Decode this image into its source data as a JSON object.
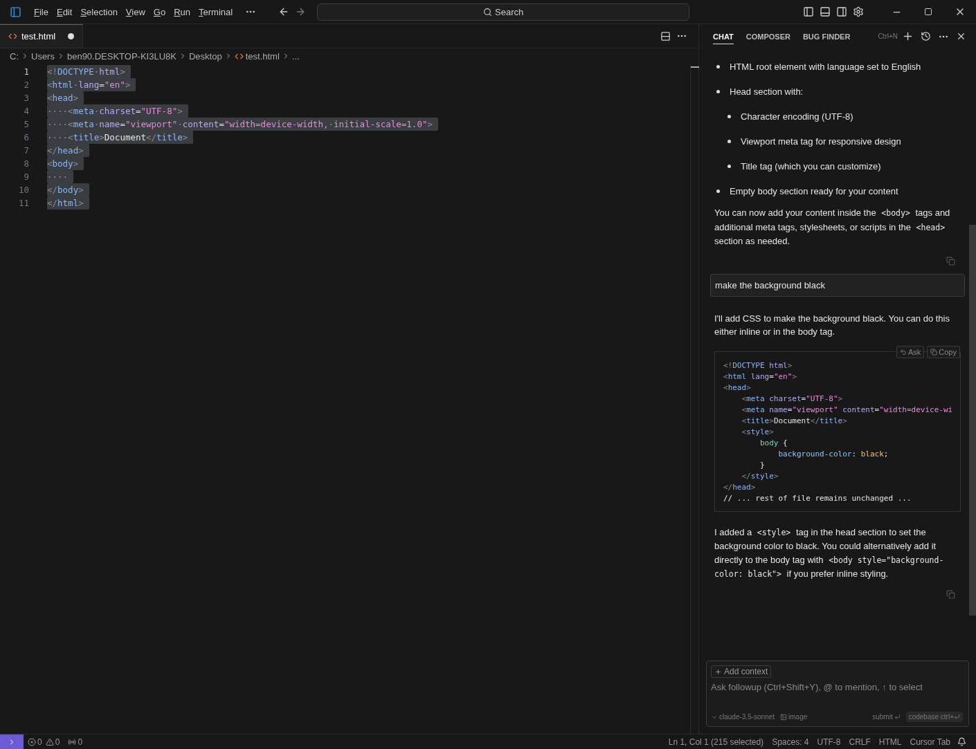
{
  "menu": [
    "File",
    "Edit",
    "Selection",
    "View",
    "Go",
    "Run",
    "Terminal"
  ],
  "search": {
    "placeholder": "Search"
  },
  "editor_tabs": [
    {
      "label": "test.html",
      "selected": true,
      "modified": true
    }
  ],
  "breadcrumb": [
    "C:",
    "Users",
    "ben90.DESKTOP-KI3LU8K",
    "Desktop",
    "test.html",
    "..."
  ],
  "code_lines": [
    {
      "number": "1",
      "current": true,
      "selected": true,
      "tokens": [
        {
          "kind": "p",
          "text": "<!"
        },
        {
          "kind": "tag",
          "text": "DOCTYPE"
        },
        {
          "kind": "ws",
          "text": "·"
        },
        {
          "kind": "attr",
          "text": "html"
        },
        {
          "kind": "p",
          "text": ">"
        }
      ]
    },
    {
      "number": "2",
      "current": false,
      "selected": true,
      "tokens": [
        {
          "kind": "p",
          "text": "<"
        },
        {
          "kind": "tag",
          "text": "html"
        },
        {
          "kind": "ws",
          "text": "·"
        },
        {
          "kind": "attr",
          "text": "lang"
        },
        {
          "kind": "txt",
          "text": "="
        },
        {
          "kind": "str",
          "text": "\"en\""
        },
        {
          "kind": "p",
          "text": ">"
        }
      ]
    },
    {
      "number": "3",
      "current": false,
      "selected": true,
      "tokens": [
        {
          "kind": "p",
          "text": "<"
        },
        {
          "kind": "tag",
          "text": "head"
        },
        {
          "kind": "p",
          "text": ">"
        }
      ]
    },
    {
      "number": "4",
      "current": false,
      "selected": true,
      "tokens": [
        {
          "kind": "ws",
          "text": "····"
        },
        {
          "kind": "p",
          "text": "<"
        },
        {
          "kind": "tag",
          "text": "meta"
        },
        {
          "kind": "ws",
          "text": "·"
        },
        {
          "kind": "attr",
          "text": "charset"
        },
        {
          "kind": "txt",
          "text": "="
        },
        {
          "kind": "str",
          "text": "\"UTF-8\""
        },
        {
          "kind": "p",
          "text": ">"
        }
      ]
    },
    {
      "number": "5",
      "current": false,
      "selected": true,
      "tokens": [
        {
          "kind": "ws",
          "text": "····"
        },
        {
          "kind": "p",
          "text": "<"
        },
        {
          "kind": "tag",
          "text": "meta"
        },
        {
          "kind": "ws",
          "text": "·"
        },
        {
          "kind": "attr",
          "text": "name"
        },
        {
          "kind": "txt",
          "text": "="
        },
        {
          "kind": "str",
          "text": "\"viewport\""
        },
        {
          "kind": "ws",
          "text": "·"
        },
        {
          "kind": "attr",
          "text": "content"
        },
        {
          "kind": "txt",
          "text": "="
        },
        {
          "kind": "str",
          "text": "\"width=device-width,"
        },
        {
          "kind": "ws",
          "text": "·"
        },
        {
          "kind": "str",
          "text": "initial-scale=1.0\""
        },
        {
          "kind": "p",
          "text": ">"
        }
      ]
    },
    {
      "number": "6",
      "current": false,
      "selected": true,
      "tokens": [
        {
          "kind": "ws",
          "text": "····"
        },
        {
          "kind": "p",
          "text": "<"
        },
        {
          "kind": "tag",
          "text": "title"
        },
        {
          "kind": "p",
          "text": ">"
        },
        {
          "kind": "txt",
          "text": "Document"
        },
        {
          "kind": "p",
          "text": "</"
        },
        {
          "kind": "tag",
          "text": "title"
        },
        {
          "kind": "p",
          "text": ">"
        }
      ]
    },
    {
      "number": "7",
      "current": false,
      "selected": true,
      "tokens": [
        {
          "kind": "p",
          "text": "</"
        },
        {
          "kind": "tag",
          "text": "head"
        },
        {
          "kind": "p",
          "text": ">"
        }
      ]
    },
    {
      "number": "8",
      "current": false,
      "selected": true,
      "tokens": [
        {
          "kind": "p",
          "text": "<"
        },
        {
          "kind": "tag",
          "text": "body"
        },
        {
          "kind": "p",
          "text": ">"
        }
      ]
    },
    {
      "number": "9",
      "current": false,
      "selected": true,
      "tokens": [
        {
          "kind": "ws",
          "text": "····"
        }
      ]
    },
    {
      "number": "10",
      "current": false,
      "selected": true,
      "tokens": [
        {
          "kind": "p",
          "text": "</"
        },
        {
          "kind": "tag",
          "text": "body"
        },
        {
          "kind": "p",
          "text": ">"
        }
      ]
    },
    {
      "number": "11",
      "current": false,
      "selected": true,
      "tokens": [
        {
          "kind": "p",
          "text": "</"
        },
        {
          "kind": "tag",
          "text": "html"
        },
        {
          "kind": "p",
          "text": ">"
        }
      ]
    }
  ],
  "chat": {
    "tabs": [
      {
        "label": "CHAT",
        "selected": true
      },
      {
        "label": "COMPOSER",
        "selected": false
      },
      {
        "label": "BUG FINDER",
        "selected": false
      }
    ],
    "shortcut": "Ctrl+N",
    "bullets": [
      {
        "text": "HTML root element with language set to English"
      },
      {
        "text": "Head section with:",
        "children": [
          {
            "text": "Character encoding (UTF-8)"
          },
          {
            "text": "Viewport meta tag for responsive design"
          },
          {
            "text": "Title tag (which you can customize)"
          }
        ]
      },
      {
        "text": "Empty body section ready for your content"
      }
    ],
    "summary": [
      {
        "kind": "text",
        "text": "You can now add your content inside the "
      },
      {
        "kind": "code",
        "text": "<body>"
      },
      {
        "kind": "text",
        "text": " tags and additional meta tags, stylesheets, or scripts in the "
      },
      {
        "kind": "code",
        "text": "<head>"
      },
      {
        "kind": "text",
        "text": " section as needed."
      }
    ],
    "user_message": "make the background black",
    "reply_intro": "I'll add CSS to make the background black. You can do this either inline or in the body tag.",
    "code_actions": [
      "Ask",
      "Copy"
    ],
    "code_block": [
      [
        {
          "kind": "p",
          "text": "<!"
        },
        {
          "kind": "tag",
          "text": "DOCTYPE"
        },
        {
          "kind": "attr",
          "text": " html"
        },
        {
          "kind": "p",
          "text": ">"
        }
      ],
      [
        {
          "kind": "p",
          "text": "<"
        },
        {
          "kind": "tag",
          "text": "html"
        },
        {
          "kind": "attr",
          "text": " lang"
        },
        {
          "kind": "txt",
          "text": "="
        },
        {
          "kind": "str",
          "text": "\"en\""
        },
        {
          "kind": "p",
          "text": ">"
        }
      ],
      [
        {
          "kind": "p",
          "text": "<"
        },
        {
          "kind": "tag",
          "text": "head"
        },
        {
          "kind": "p",
          "text": ">"
        }
      ],
      [
        {
          "kind": "p",
          "text": "    <"
        },
        {
          "kind": "tag",
          "text": "meta"
        },
        {
          "kind": "attr",
          "text": " charset"
        },
        {
          "kind": "txt",
          "text": "="
        },
        {
          "kind": "str",
          "text": "\"UTF-8\""
        },
        {
          "kind": "p",
          "text": ">"
        }
      ],
      [
        {
          "kind": "p",
          "text": "    <"
        },
        {
          "kind": "tag",
          "text": "meta"
        },
        {
          "kind": "attr",
          "text": " name"
        },
        {
          "kind": "txt",
          "text": "="
        },
        {
          "kind": "str",
          "text": "\"viewport\""
        },
        {
          "kind": "attr",
          "text": " content"
        },
        {
          "kind": "txt",
          "text": "="
        },
        {
          "kind": "str",
          "text": "\"width=device-wi"
        }
      ],
      [
        {
          "kind": "p",
          "text": "    <"
        },
        {
          "kind": "tag",
          "text": "title"
        },
        {
          "kind": "p",
          "text": ">"
        },
        {
          "kind": "txt",
          "text": "Document"
        },
        {
          "kind": "p",
          "text": "</"
        },
        {
          "kind": "tag",
          "text": "title"
        },
        {
          "kind": "p",
          "text": ">"
        }
      ],
      [
        {
          "kind": "p",
          "text": "    <"
        },
        {
          "kind": "tag",
          "text": "style"
        },
        {
          "kind": "p",
          "text": ">"
        }
      ],
      [
        {
          "kind": "sel",
          "text": "        body"
        },
        {
          "kind": "txt",
          "text": " {"
        }
      ],
      [
        {
          "kind": "prop",
          "text": "            background-color"
        },
        {
          "kind": "txt",
          "text": ": "
        },
        {
          "kind": "val",
          "text": "black"
        },
        {
          "kind": "txt",
          "text": ";"
        }
      ],
      [
        {
          "kind": "txt",
          "text": "        }"
        }
      ],
      [
        {
          "kind": "p",
          "text": "    </"
        },
        {
          "kind": "tag",
          "text": "style"
        },
        {
          "kind": "p",
          "text": ">"
        }
      ],
      [
        {
          "kind": "p",
          "text": "</"
        },
        {
          "kind": "tag",
          "text": "head"
        },
        {
          "kind": "p",
          "text": ">"
        }
      ],
      [
        {
          "kind": "txt",
          "text": "// ... rest of file remains unchanged ..."
        }
      ]
    ],
    "reply_outro": [
      {
        "kind": "text",
        "text": "I added a "
      },
      {
        "kind": "code",
        "text": "<style>"
      },
      {
        "kind": "text",
        "text": " tag in the head section to set the background color to black. You could alternatively add it directly to the body tag with "
      },
      {
        "kind": "code",
        "text": "<body style=\"background-color: black\">"
      },
      {
        "kind": "text",
        "text": " if you prefer inline styling."
      }
    ],
    "composer": {
      "add_context": "Add context",
      "placeholder": "Ask followup (Ctrl+Shift+Y), @ to mention, ↑ to select",
      "model": "claude-3.5-sonnet",
      "image": "image",
      "submit": "submit",
      "codebase": "codebase ctrl+"
    }
  },
  "status_bar": {
    "errors": "0",
    "warnings": "0",
    "ports": "0",
    "right": [
      "Ln 1, Col 1 (215 selected)",
      "Spaces: 4",
      "UTF-8",
      "CRLF",
      "HTML",
      "Cursor Tab"
    ]
  }
}
